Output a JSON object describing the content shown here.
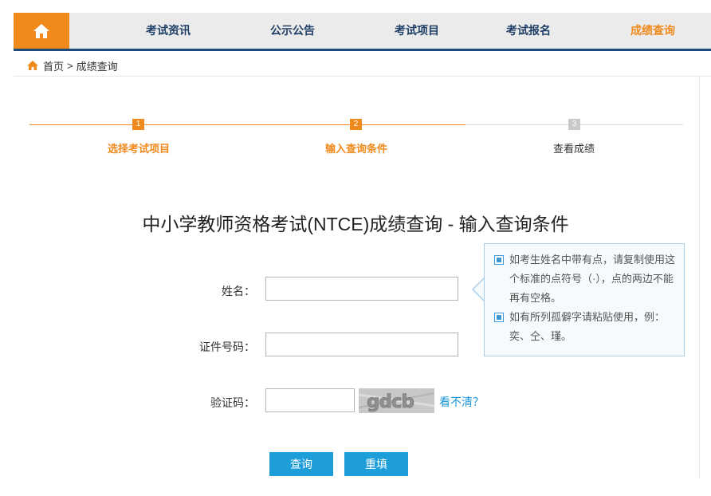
{
  "nav": {
    "items": [
      {
        "label": "考试资讯"
      },
      {
        "label": "公示公告"
      },
      {
        "label": "考试项目"
      },
      {
        "label": "考试报名"
      },
      {
        "label": "成绩查询"
      }
    ]
  },
  "breadcrumb": {
    "home": "首页",
    "separator": ">",
    "current": "成绩查询"
  },
  "steps": [
    {
      "num": "1",
      "label": "选择考试项目",
      "state": "done"
    },
    {
      "num": "2",
      "label": "输入查询条件",
      "state": "active"
    },
    {
      "num": "3",
      "label": "查看成绩",
      "state": "pending"
    }
  ],
  "title": "中小学教师资格考试(NTCE)成绩查询 - 输入查询条件",
  "form": {
    "name_label": "姓名：",
    "name_value": "",
    "id_label": "证件号码：",
    "id_value": "",
    "captcha_label": "验证码：",
    "captcha_value": "",
    "captcha_image_text": "gdcb",
    "captcha_refresh": "看不清？"
  },
  "tips": [
    "如考生姓名中带有点，请复制使用这个标准的点符号（·），点的两边不能再有空格。",
    "如有所列孤僻字请粘贴使用，例：奕、仝、瑾。"
  ],
  "buttons": {
    "query": "查询",
    "reset": "重填"
  },
  "colors": {
    "accent": "#f08a1d",
    "nav_border": "#1f4a7c",
    "button": "#1d9ed8",
    "link": "#1a96d4"
  },
  "icons": {
    "home": "home-icon",
    "breadcrumb_home": "home-icon",
    "tip_bullet": "square-bullet-icon"
  }
}
